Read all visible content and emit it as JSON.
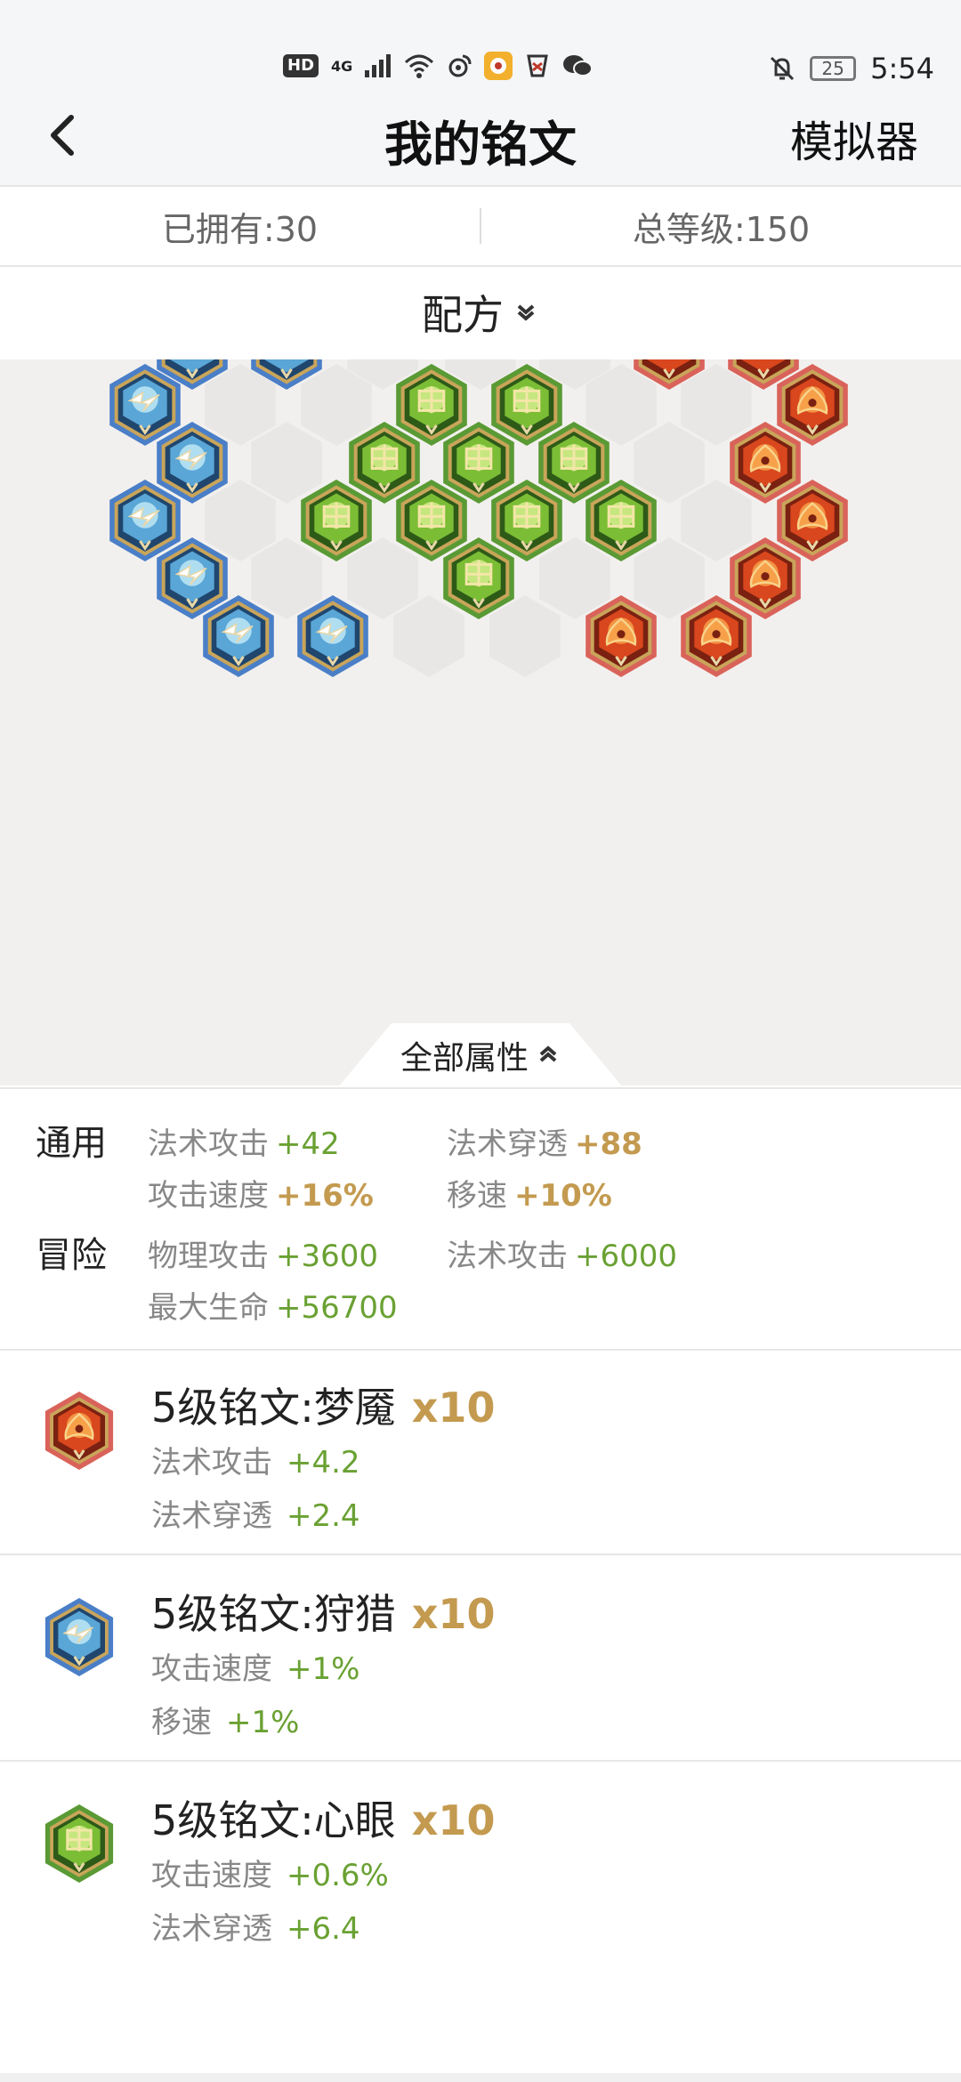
{
  "status_bar": {
    "hd": "HD",
    "network": "4G",
    "battery": "25",
    "time": "5:54",
    "icons": [
      "hd-icon",
      "signal-icon",
      "wifi-icon",
      "weibo-icon",
      "app-icon",
      "app-icon-2",
      "wechat-icon",
      "mute-bell-icon",
      "battery-icon"
    ]
  },
  "header": {
    "title": "我的铭文",
    "right_action": "模拟器"
  },
  "summary": {
    "owned": "已拥有:30",
    "total_level": "总等级:150"
  },
  "recipe": {
    "label": "配方"
  },
  "board": {
    "colors": {
      "blue": "#4a7fc8",
      "green": "#5a9a35",
      "red": "#d9635a",
      "empty": "#e9e7e5"
    },
    "rune_names": {
      "blue": "狩猎",
      "green": "心眼",
      "red": "梦魇"
    }
  },
  "all_attributes": {
    "label": "全部属性"
  },
  "stats": {
    "general": {
      "label": "通用",
      "items": [
        {
          "name": "法术攻击",
          "value": "+42"
        },
        {
          "name": "法术穿透",
          "value": "+88"
        },
        {
          "name": "攻击速度",
          "value": "+16%"
        },
        {
          "name": "移速",
          "value": "+10%"
        }
      ]
    },
    "adventure": {
      "label": "冒险",
      "items": [
        {
          "name": "物理攻击",
          "value": "+3600"
        },
        {
          "name": "法术攻击",
          "value": "+6000"
        },
        {
          "name": "最大生命",
          "value": "+56700"
        }
      ]
    }
  },
  "runes": [
    {
      "name": "5级铭文:梦魇",
      "count": "x10",
      "color": "red",
      "attrs": [
        {
          "name": "法术攻击",
          "value": "+4.2"
        },
        {
          "name": "法术穿透",
          "value": "+2.4"
        }
      ]
    },
    {
      "name": "5级铭文:狩猎",
      "count": "x10",
      "color": "blue",
      "attrs": [
        {
          "name": "攻击速度",
          "value": "+1%"
        },
        {
          "name": "移速",
          "value": "+1%"
        }
      ]
    },
    {
      "name": "5级铭文:心眼",
      "count": "x10",
      "color": "green",
      "attrs": [
        {
          "name": "攻击速度",
          "value": "+0.6%"
        },
        {
          "name": "法术穿透",
          "value": "+6.4"
        }
      ]
    }
  ]
}
